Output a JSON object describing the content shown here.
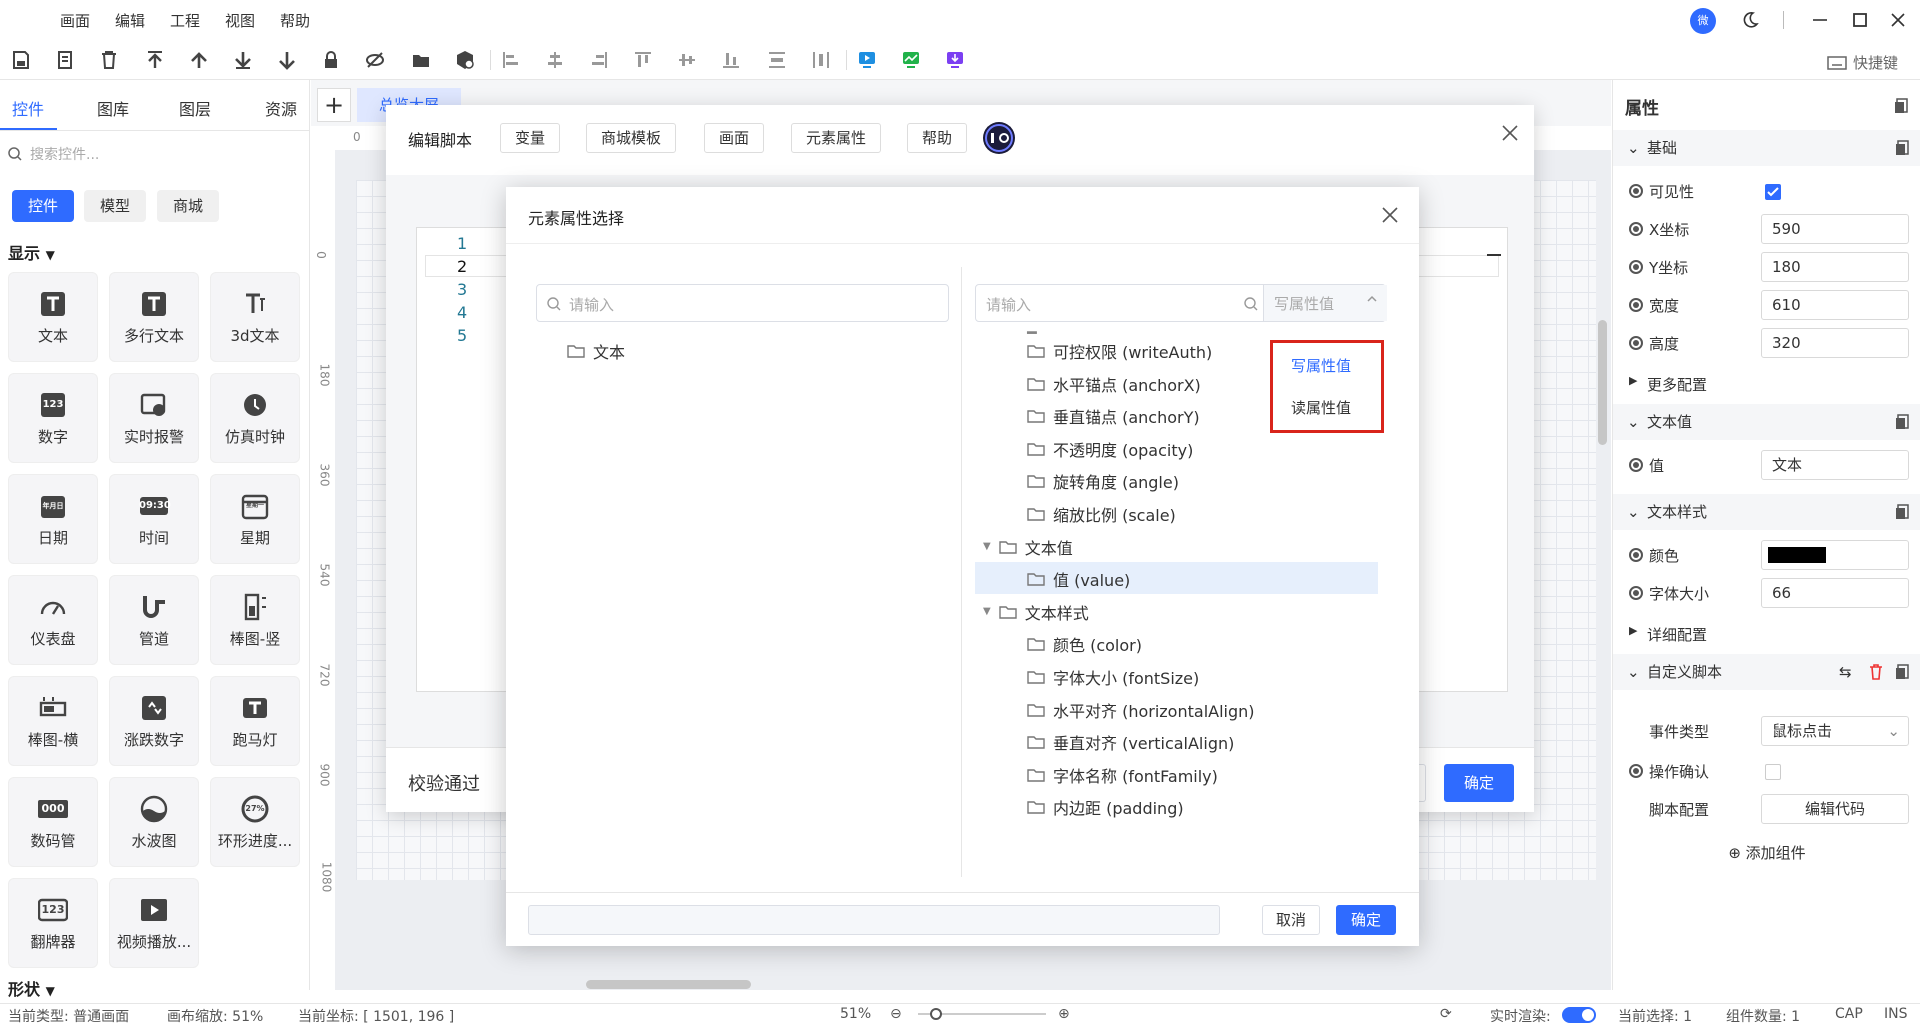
{
  "menubar": {
    "items": [
      "画面",
      "编辑",
      "工程",
      "视图",
      "帮助"
    ],
    "avatar": "微"
  },
  "toolbar": {
    "shortcuts": "快捷键"
  },
  "left": {
    "tabs": [
      "控件",
      "图库",
      "图层",
      "资源"
    ],
    "search_placeholder": "搜索控件...",
    "chips": [
      "控件",
      "模型",
      "商城"
    ],
    "section_display": "显示",
    "section_shape": "形状",
    "widgets": [
      {
        "label": "文本",
        "icon": "text-icon"
      },
      {
        "label": "多行文本",
        "icon": "multiline-text-icon"
      },
      {
        "label": "3d文本",
        "icon": "3d-text-icon"
      },
      {
        "label": "数字",
        "icon": "number-icon"
      },
      {
        "label": "实时报警",
        "icon": "alarm-icon"
      },
      {
        "label": "仿真时钟",
        "icon": "clock-icon"
      },
      {
        "label": "日期",
        "icon": "date-icon"
      },
      {
        "label": "时间",
        "icon": "time-icon"
      },
      {
        "label": "星期",
        "icon": "week-icon"
      },
      {
        "label": "仪表盘",
        "icon": "gauge-icon"
      },
      {
        "label": "管道",
        "icon": "pipe-icon"
      },
      {
        "label": "棒图-竖",
        "icon": "bar-vertical-icon"
      },
      {
        "label": "棒图-横",
        "icon": "bar-horizontal-icon"
      },
      {
        "label": "涨跌数字",
        "icon": "updown-number-icon"
      },
      {
        "label": "跑马灯",
        "icon": "marquee-icon"
      },
      {
        "label": "数码管",
        "icon": "digital-tube-icon"
      },
      {
        "label": "水波图",
        "icon": "water-wave-icon"
      },
      {
        "label": "环形进度...",
        "icon": "ring-progress-icon"
      },
      {
        "label": "翻牌器",
        "icon": "flip-counter-icon"
      },
      {
        "label": "视频播放...",
        "icon": "video-player-icon"
      }
    ],
    "widget_texts": {
      "num": "123",
      "date": "年月日",
      "time": "09:30",
      "week": "星期一",
      "ring": "27%",
      "digit": "000",
      "flip": "123"
    }
  },
  "canvas": {
    "tab_label": "总览大屏",
    "ruler_top": [
      "0"
    ],
    "ruler_left": [
      "0",
      "180",
      "360",
      "540",
      "720",
      "900",
      "1080"
    ]
  },
  "script_dialog": {
    "title": "编辑脚本",
    "buttons": [
      "变量",
      "商城模板",
      "画面",
      "元素属性",
      "帮助"
    ],
    "line_numbers": [
      "1",
      "2",
      "3",
      "4",
      "5"
    ],
    "status": "校验通过",
    "confirm": "确定"
  },
  "attr_dialog": {
    "title": "元素属性选择",
    "left_placeholder": "请输入",
    "right_placeholder": "请输入",
    "mode_value": "写属性值",
    "left_tree": [
      "文本"
    ],
    "right_tree": [
      {
        "label": "可控权限 (writeAuth)",
        "level": 2
      },
      {
        "label": "水平锚点 (anchorX)",
        "level": 2
      },
      {
        "label": "垂直锚点 (anchorY)",
        "level": 2
      },
      {
        "label": "不透明度 (opacity)",
        "level": 2
      },
      {
        "label": "旋转角度 (angle)",
        "level": 2
      },
      {
        "label": "缩放比例 (scale)",
        "level": 2
      },
      {
        "label": "文本值",
        "level": 1
      },
      {
        "label": "值 (value)",
        "level": 2,
        "selected": true
      },
      {
        "label": "文本样式",
        "level": 1
      },
      {
        "label": "颜色 (color)",
        "level": 2
      },
      {
        "label": "字体大小 (fontSize)",
        "level": 2
      },
      {
        "label": "水平对齐 (horizontalAlign)",
        "level": 2
      },
      {
        "label": "垂直对齐 (verticalAlign)",
        "level": 2
      },
      {
        "label": "字体名称 (fontFamily)",
        "level": 2
      },
      {
        "label": "内边距 (padding)",
        "level": 2
      }
    ],
    "dropdown_options": [
      "写属性值",
      "读属性值"
    ],
    "cancel": "取消",
    "confirm": "确定"
  },
  "properties": {
    "title": "属性",
    "basic": "基础",
    "visible": "可见性",
    "x_label": "X坐标",
    "x_value": "590",
    "y_label": "Y坐标",
    "y_value": "180",
    "w_label": "宽度",
    "w_value": "610",
    "h_label": "高度",
    "h_value": "320",
    "more_config": "更多配置",
    "text_value_section": "文本值",
    "value_label": "值",
    "value_value": "文本",
    "text_style_section": "文本样式",
    "color_label": "颜色",
    "color_value": "#000000",
    "font_size_label": "字体大小",
    "font_size_value": "66",
    "detail_config": "详细配置",
    "custom_script": "自定义脚本",
    "event_type_label": "事件类型",
    "event_type_value": "鼠标点击",
    "confirm_label": "操作确认",
    "script_config_label": "脚本配置",
    "edit_code": "编辑代码",
    "add_component": "添加组件"
  },
  "status": {
    "current_type": "当前类型: 普通画面",
    "canvas_zoom": "画布缩放: 51%",
    "current_coord": "当前坐标: [ 1501, 196 ]",
    "zoom": "51%",
    "realtime": "实时渲染:",
    "selection": "当前选择: 1",
    "component_count": "组件数量: 1",
    "cap": "CAP",
    "ins": "INS"
  },
  "colors": {
    "accent": "#2f6bff",
    "highlight_border": "#d9241b"
  }
}
